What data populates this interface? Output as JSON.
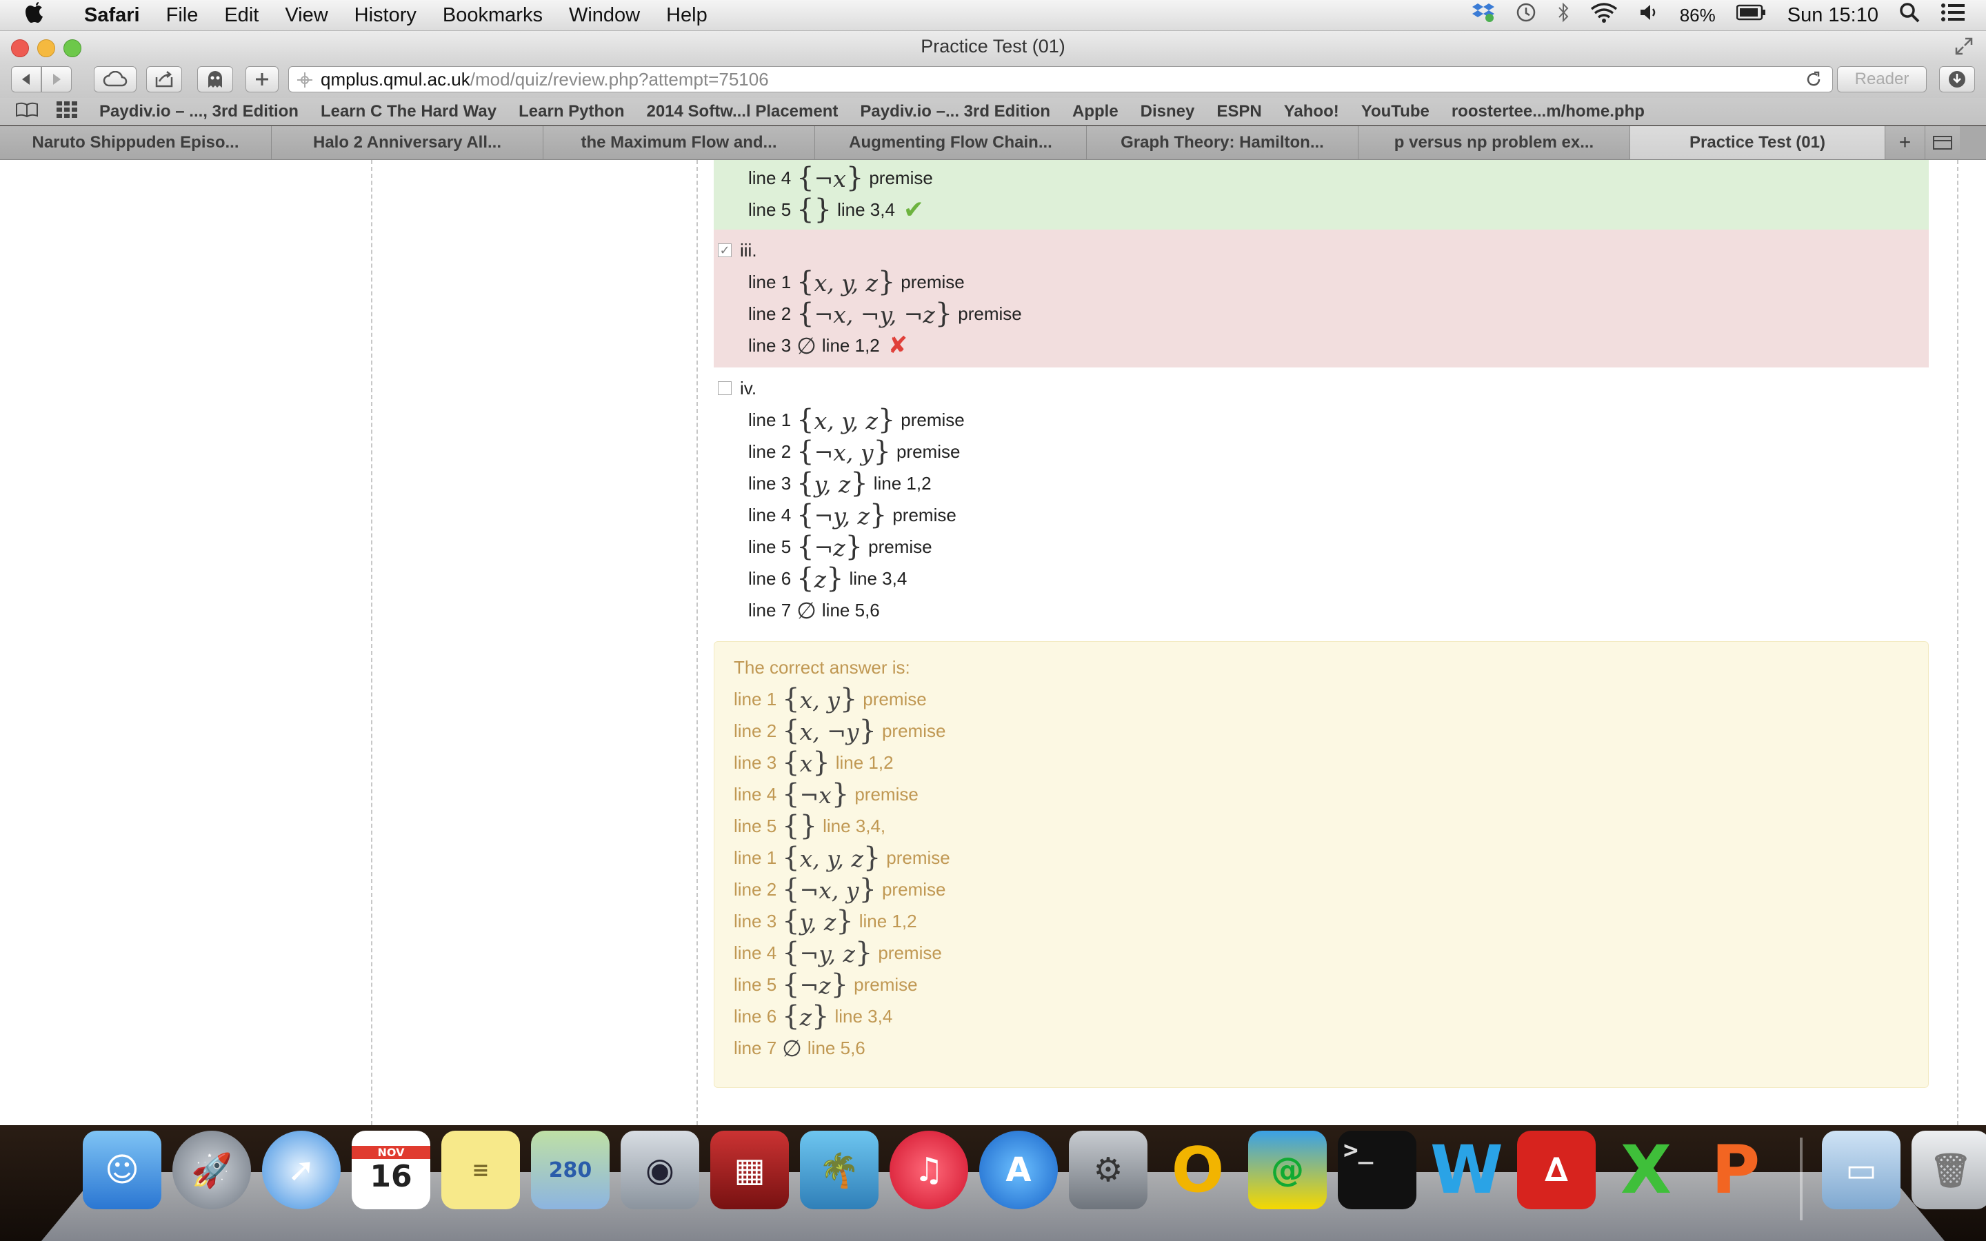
{
  "menubar": {
    "app": "Safari",
    "items": [
      "File",
      "Edit",
      "View",
      "History",
      "Bookmarks",
      "Window",
      "Help"
    ],
    "battery": "86%",
    "clock": "Sun 15:10"
  },
  "window": {
    "title": "Practice Test (01)"
  },
  "toolbar": {
    "url_host": "qmplus.qmul.ac.uk",
    "url_path": "/mod/quiz/review.php?attempt=75106",
    "reader": "Reader"
  },
  "bookmarks": [
    "Paydiv.io – ..., 3rd Edition",
    "Learn C The Hard Way",
    "Learn Python",
    "2014 Softw...l Placement",
    "Paydiv.io –... 3rd Edition",
    "Apple",
    "Disney",
    "ESPN",
    "Yahoo!",
    "YouTube",
    "roostertee...m/home.php"
  ],
  "tabs": [
    "Naruto Shippuden Episo...",
    "Halo 2 Anniversary All...",
    "the Maximum Flow and...",
    "Augmenting Flow Chain...",
    "Graph Theory: Hamilton...",
    "p versus np problem ex...",
    "Practice Test (01)"
  ],
  "question": {
    "partial_top": [
      {
        "label": "line 4",
        "set": "¬x",
        "just": "premise"
      },
      {
        "label": "line 5",
        "set": "",
        "just": "line 3,4"
      }
    ],
    "option_iii": {
      "label": "iii.",
      "lines": [
        {
          "label": "line 1",
          "set": "x, y, z",
          "just": "premise"
        },
        {
          "label": "line 2",
          "set": "¬x, ¬y, ¬z",
          "just": "premise"
        },
        {
          "label": "line 3",
          "set": "∅",
          "just": "line 1,2"
        }
      ]
    },
    "option_iv": {
      "label": "iv.",
      "lines": [
        {
          "label": "line 1",
          "set": "x, y, z",
          "just": "premise"
        },
        {
          "label": "line 2",
          "set": "¬x, y",
          "just": "premise"
        },
        {
          "label": "line 3",
          "set": "y, z",
          "just": "line 1,2"
        },
        {
          "label": "line 4",
          "set": "¬y, z",
          "just": "premise"
        },
        {
          "label": "line 5",
          "set": "¬z",
          "just": "premise"
        },
        {
          "label": "line 6",
          "set": "z",
          "just": "line 3,4"
        },
        {
          "label": "line 7",
          "set": "∅",
          "just": "line 5,6"
        }
      ]
    },
    "correct": {
      "heading": "The correct answer is:",
      "lines": [
        {
          "label": "line 1",
          "set": "x, y",
          "just": "premise"
        },
        {
          "label": "line 2",
          "set": "x, ¬y",
          "just": "premise"
        },
        {
          "label": "line 3",
          "set": "x",
          "just": "line 1,2"
        },
        {
          "label": "line 4",
          "set": "¬x",
          "just": "premise"
        },
        {
          "label": "line 5",
          "set": "",
          "just": "line 3,4,"
        },
        {
          "label": "line 1",
          "set": "x, y, z",
          "just": "premise"
        },
        {
          "label": "line 2",
          "set": "¬x, y",
          "just": "premise"
        },
        {
          "label": "line 3",
          "set": "y, z",
          "just": "line 1,2"
        },
        {
          "label": "line 4",
          "set": "¬y, z",
          "just": "premise"
        },
        {
          "label": "line 5",
          "set": "¬z",
          "just": "premise"
        },
        {
          "label": "line 6",
          "set": "z",
          "just": "line 3,4"
        },
        {
          "label": "line 7",
          "set": "∅",
          "just": "line 5,6"
        }
      ]
    }
  },
  "dock": {
    "calendar_month": "NOV",
    "calendar_day": "16",
    "apps": [
      "finder-icon",
      "launchpad-icon",
      "safari-icon",
      "calendar-icon",
      "stickies-icon",
      "maps-icon",
      "facetime-icon",
      "photobooth-icon",
      "iphoto-icon",
      "itunes-icon",
      "appstore-icon",
      "system-preferences-icon",
      "outlook-icon",
      "webstorm-icon",
      "terminal-icon",
      "word-icon",
      "acrobat-icon",
      "excel-icon",
      "powerpoint-icon",
      "downloads-folder-icon",
      "trash-icon"
    ]
  }
}
